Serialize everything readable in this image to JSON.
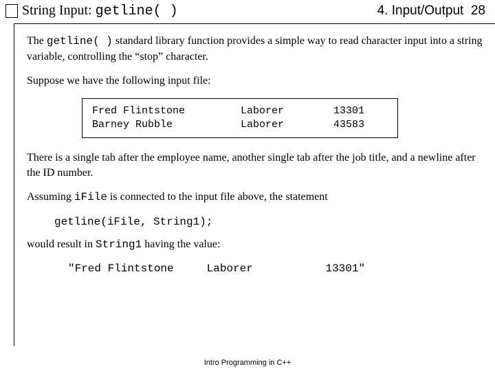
{
  "header": {
    "title_prefix": "String Input: ",
    "title_code": "getline( )",
    "chapter": "4. Input/Output",
    "page": "28"
  },
  "para1": {
    "t1": "The ",
    "code": "getline( )",
    "t2": " standard library function provides a simple way to read character input into a string variable, controlling the “stop” character."
  },
  "para2": "Suppose we have the following input file:",
  "file": "Fred Flintstone         Laborer        13301\nBarney Rubble           Laborer        43583",
  "para3": "There is a single tab after the employee name, another single tab after the job title, and a newline after the ID number.",
  "para4": {
    "t1": "Assuming ",
    "code": "iFile",
    "t2": " is connected to the input file above, the statement"
  },
  "code_statement": "getline(iFile, String1);",
  "para5": {
    "t1": "would result in ",
    "code": "String1",
    "t2": " having the value:"
  },
  "result": "\"Fred Flintstone     Laborer           13301\"",
  "footer": "Intro Programming in C++"
}
